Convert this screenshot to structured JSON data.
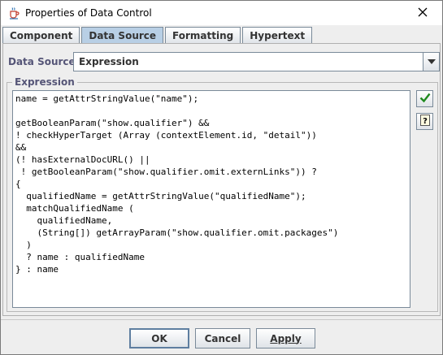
{
  "window": {
    "title": "Properties of Data Control",
    "icons": {
      "app": "java-cup-icon",
      "close": "close-icon"
    }
  },
  "tabs": [
    {
      "label": "Component",
      "active": false
    },
    {
      "label": "Data Source",
      "active": true
    },
    {
      "label": "Formatting",
      "active": false
    },
    {
      "label": "Hypertext",
      "active": false
    }
  ],
  "data_source": {
    "label": "Data Source:",
    "selected": "Expression",
    "dropdown_icon": "chevron-down-icon"
  },
  "expression": {
    "group_label": "Expression",
    "code": "name = getAttrStringValue(\"name\");\n\ngetBooleanParam(\"show.qualifier\") &&\n! checkHyperTarget (Array (contextElement.id, \"detail\"))\n&&\n(! hasExternalDocURL() ||\n ! getBooleanParam(\"show.qualifier.omit.externLinks\")) ?\n{\n  qualifiedName = getAttrStringValue(\"qualifiedName\");\n  matchQualifiedName (\n    qualifiedName,\n    (String[]) getArrayParam(\"show.qualifier.omit.packages\")\n  )\n  ? name : qualifiedName\n} : name",
    "side_buttons": [
      "check-icon",
      "help-icon"
    ]
  },
  "buttons": {
    "ok": "OK",
    "cancel": "Cancel",
    "apply": "Apply"
  },
  "colors": {
    "active_tab": "#b8cfe5",
    "label_text": "#555577",
    "check_green": "#1f8a1f"
  }
}
